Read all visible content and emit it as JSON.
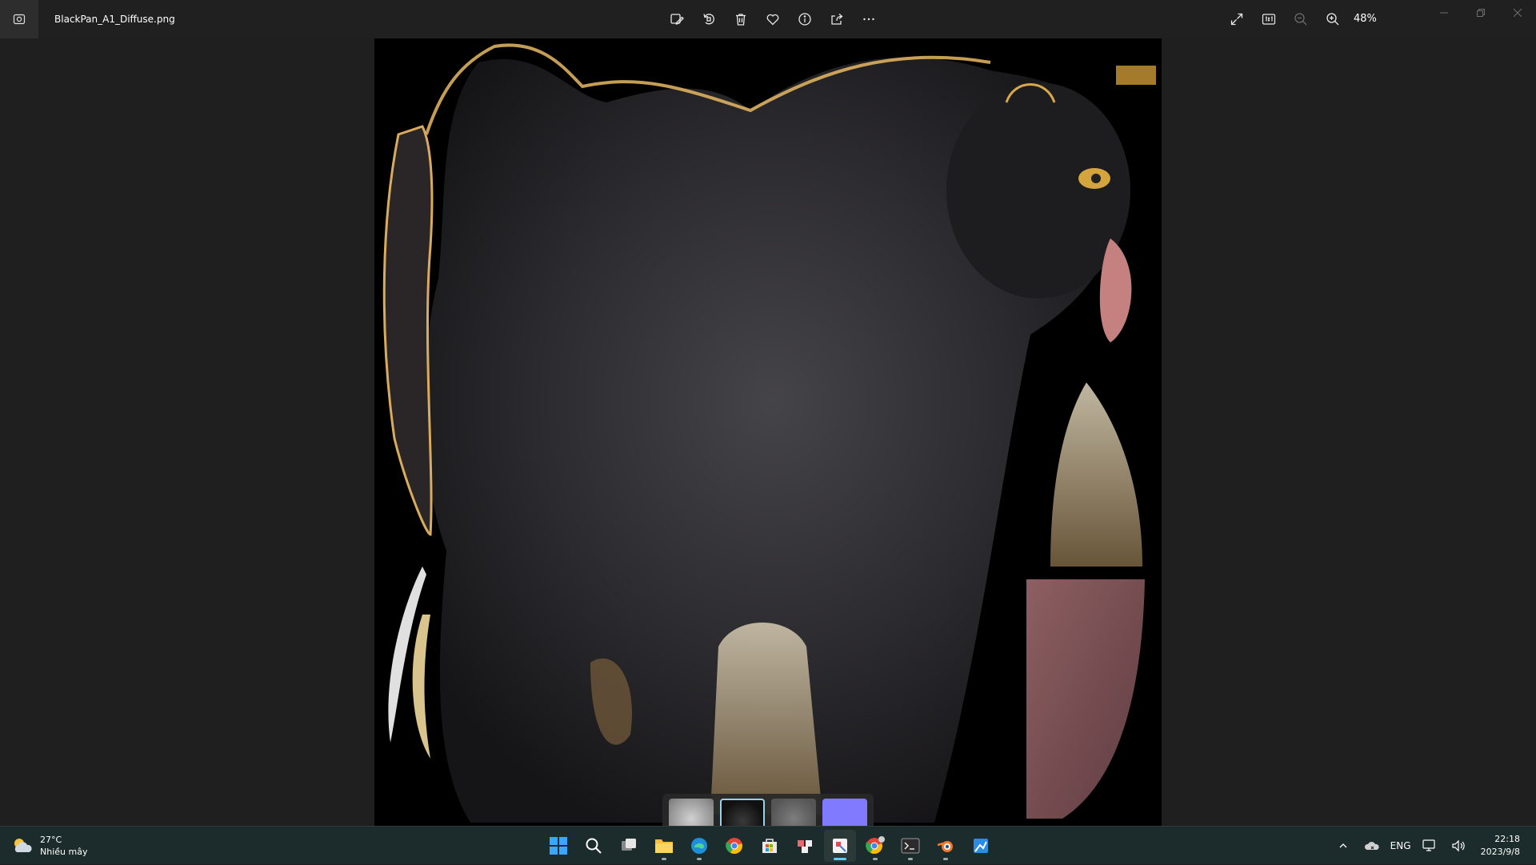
{
  "window": {
    "filename": "BlackPan_A1_Diffuse.png",
    "zoom": "48%"
  },
  "toolbar": {
    "center_icons": [
      "edit-image-icon",
      "rotate-icon",
      "delete-icon",
      "favorite-icon",
      "info-icon",
      "share-icon",
      "more-icon"
    ],
    "right_icons": [
      "fullscreen-icon",
      "actual-size-icon",
      "zoom-out-icon",
      "zoom-in-icon"
    ]
  },
  "filmstrip": {
    "thumbnail_count": 4,
    "selected_index": 1
  },
  "taskbar": {
    "weather": {
      "temperature": "27°C",
      "condition": "Nhiều mây"
    },
    "language": "ENG",
    "time": "22:18",
    "date": "2023/9/8"
  },
  "colors": {
    "accent": "#60cdff",
    "titlebar": "#202020",
    "canvas": "#1f1f1f",
    "taskbar": "#1c2b2b"
  }
}
